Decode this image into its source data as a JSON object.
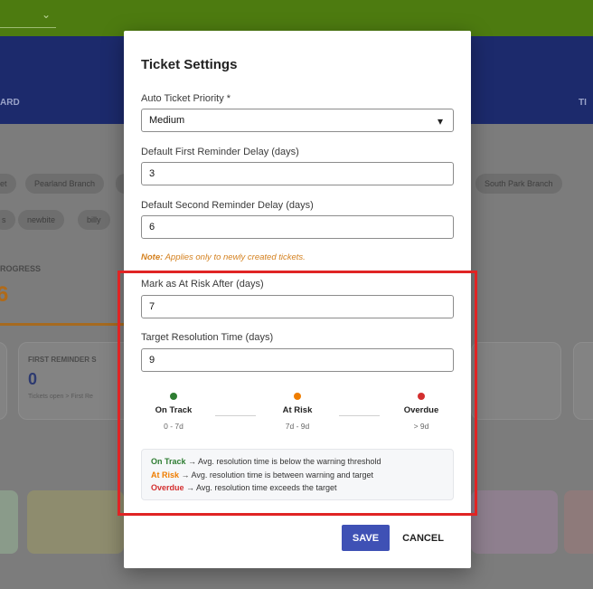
{
  "background": {
    "nav_left": "ARD",
    "nav_right": "TI",
    "chips_row1": [
      "et",
      "Pearland Branch",
      "",
      "South Park Branch"
    ],
    "chips_row2": [
      "s",
      "newbite",
      "billy"
    ],
    "progress_label": "ROGRESS",
    "progress_value": "6",
    "card": {
      "title": "FIRST REMINDER S",
      "value": "0",
      "subtitle": "Tickets open > First Re"
    }
  },
  "modal": {
    "title": "Ticket Settings",
    "priority": {
      "label": "Auto Ticket Priority *",
      "value": "Medium",
      "options": [
        "Medium"
      ]
    },
    "first_reminder": {
      "label": "Default First Reminder Delay (days)",
      "value": "3"
    },
    "second_reminder": {
      "label": "Default Second Reminder Delay (days)",
      "value": "6"
    },
    "note": {
      "prefix": "Note:",
      "text": "Applies only to newly created tickets."
    },
    "at_risk": {
      "label": "Mark as At Risk After (days)",
      "value": "7"
    },
    "target_resolution": {
      "label": "Target Resolution Time (days)",
      "value": "9"
    },
    "legend": [
      {
        "name": "On Track",
        "range": "0 - 7d",
        "color": "#2e7d32"
      },
      {
        "name": "At Risk",
        "range": "7d - 9d",
        "color": "#ef7d00"
      },
      {
        "name": "Overdue",
        "range": "> 9d",
        "color": "#d32f2f"
      }
    ],
    "explanations": [
      {
        "key": "On Track",
        "text": "→ Avg. resolution time is below the warning threshold",
        "color": "#2e7d32"
      },
      {
        "key": "At Risk",
        "text": "→ Avg. resolution time is between warning and target",
        "color": "#ef7d00"
      },
      {
        "key": "Overdue",
        "text": "→ Avg. resolution time exceeds the target",
        "color": "#d32f2f"
      }
    ],
    "save_label": "SAVE",
    "cancel_label": "CANCEL"
  },
  "highlight_color": "#e02424"
}
